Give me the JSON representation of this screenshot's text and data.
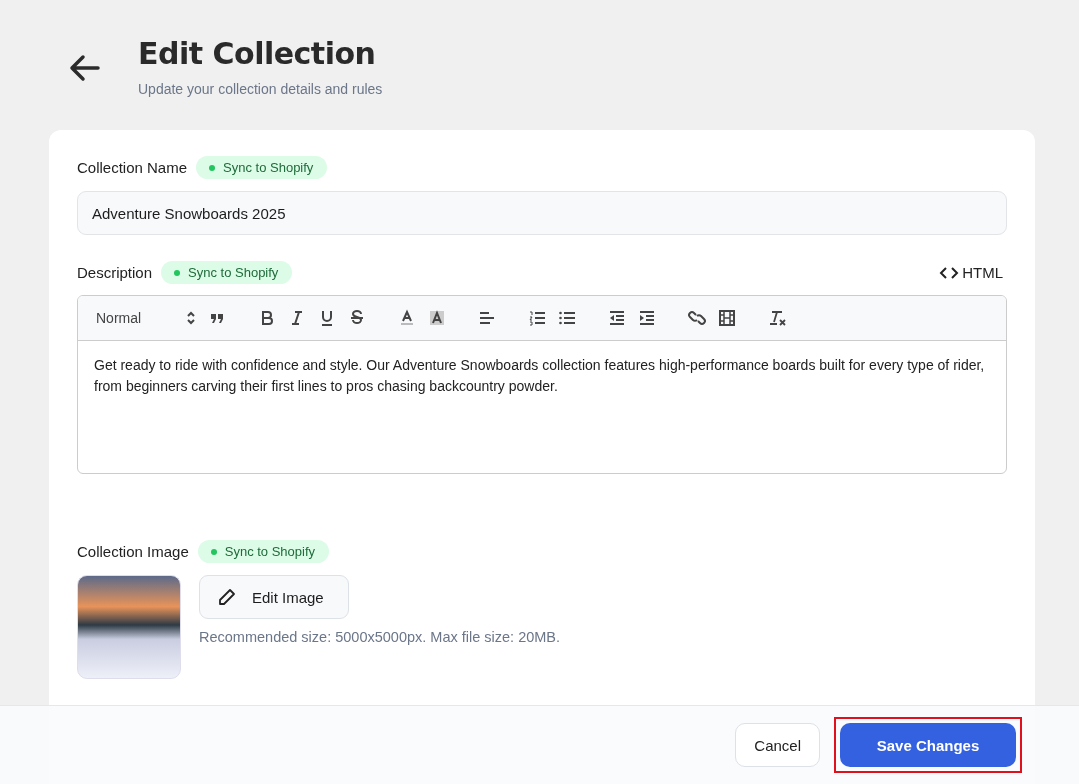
{
  "header": {
    "title": "Edit Collection",
    "subtitle": "Update your collection details and rules"
  },
  "name_field": {
    "label": "Collection Name",
    "badge": "Sync to Shopify",
    "value": "Adventure Snowboards 2025"
  },
  "description": {
    "label": "Description",
    "badge": "Sync to Shopify",
    "html_toggle": "HTML",
    "format": "Normal",
    "text": "Get ready to ride with confidence and style. Our Adventure Snowboards collection features high-performance boards built for every type of rider, from beginners carving their first lines to pros chasing backcountry powder."
  },
  "image": {
    "label": "Collection Image",
    "badge": "Sync to Shopify",
    "button": "Edit Image",
    "hint": "Recommended size: 5000x5000px. Max file size: 20MB."
  },
  "footer": {
    "buttons": [
      {
        "label": "Cancel",
        "kind": "secondary"
      },
      {
        "label": "Save Changes",
        "kind": "primary",
        "highlighted": true
      }
    ]
  }
}
